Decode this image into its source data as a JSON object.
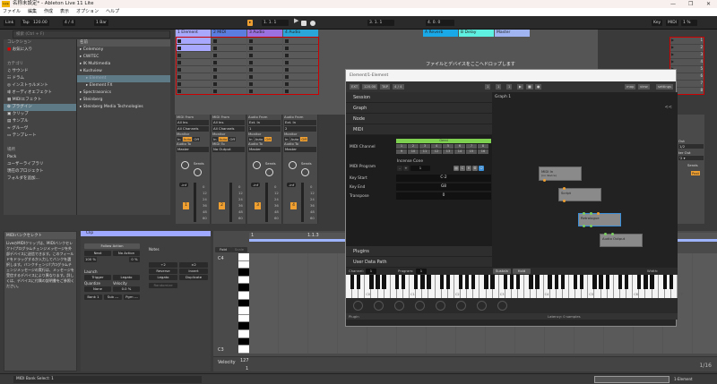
{
  "window": {
    "title": "名称未設定* - Ableton Live 11 Lite",
    "app_icon": "Live",
    "minimize": "—",
    "maximize": "❐",
    "close": "✕"
  },
  "menu": [
    "ファイル",
    "編集",
    "作成",
    "表示",
    "オプション",
    "ヘルプ"
  ],
  "toolbar": {
    "link": "Link",
    "tap": "Tap",
    "tempo": "120.00",
    "signature": "4 / 4",
    "quantize": "1 Bar",
    "position": "1.  1.  1",
    "loop_start": "3.  1.  1",
    "loop_length": "4.  0.  0",
    "key": "Key",
    "midi": "MIDI",
    "cpu": "1 %"
  },
  "browser": {
    "search_placeholder": "検索 (Ctrl + F)",
    "collections_header": "コレクション",
    "favorites": "お気に入り",
    "categories_header": "カテゴリ",
    "categories": [
      "サウンド",
      "ドラム",
      "インストゥルメント",
      "オーディオエフェクト",
      "MIDIエフェクト",
      "プラグイン",
      "クリップ",
      "サンプル",
      "グルーヴ",
      "テンプレート"
    ],
    "places_header": "場所",
    "places": [
      "Pack",
      "ユーザーライブラリ",
      "現在のプロジェクト",
      "フォルダを追加..."
    ],
    "names_header": "名前",
    "names": [
      "Celemony",
      "CWITEC",
      "IK Multimedia",
      "Kushview",
      "Element",
      "Element FX",
      "Spectrasonics",
      "Steinberg",
      "Steinberg Media Technologies"
    ]
  },
  "session": {
    "tracks": [
      {
        "name": "1 Element",
        "color": "#a8a8ff"
      },
      {
        "name": "2 MIDI",
        "color": "#5b7de0"
      },
      {
        "name": "3 Audio",
        "color": "#9b70e0"
      },
      {
        "name": "4 Audio",
        "color": "#2aa7d8"
      }
    ],
    "returns": [
      {
        "name": "A Reverb",
        "color": "#19a9e8"
      },
      {
        "name": "B Delay",
        "color": "#5ef0e0"
      },
      {
        "name": "Master",
        "color": "#9fb4f0"
      }
    ],
    "scenes": [
      "1",
      "2",
      "3",
      "4",
      "5",
      "6",
      "7",
      "8"
    ],
    "drop_text": "ファイルとデバイスをここへドロップします"
  },
  "mixer": [
    {
      "from_label": "MIDI From",
      "from": "All Ins",
      "channel": "All Channels",
      "monitor_label": "Monitor",
      "mon": [
        "In",
        "Auto",
        "Off"
      ],
      "to_label": "Audio To",
      "to": "Master",
      "sends": "Sends",
      "vol": "-inf",
      "num": "1"
    },
    {
      "from_label": "MIDI From",
      "from": "All Ins",
      "channel": "All Channels",
      "monitor_label": "Monitor",
      "mon": [
        "In",
        "Auto",
        "Off"
      ],
      "to_label": "MIDI To",
      "to": "No Output",
      "sends": "",
      "vol": "",
      "num": "2"
    },
    {
      "from_label": "Audio From",
      "from": "Ext. In",
      "channel": "1",
      "monitor_label": "Monitor",
      "mon": [
        "In",
        "Auto",
        "Off"
      ],
      "to_label": "Audio To",
      "to": "Master",
      "sends": "Sends",
      "vol": "-inf",
      "num": "3"
    },
    {
      "from_label": "Audio From",
      "from": "Ext. In",
      "channel": "2",
      "monitor_label": "Monitor",
      "mon": [
        "In",
        "Auto",
        "Off"
      ],
      "to_label": "Audio To",
      "to": "Master",
      "sends": "Sends",
      "vol": "-inf",
      "num": "4"
    }
  ],
  "meter_scale": [
    "0",
    "12",
    "24",
    "36",
    "48",
    "60"
  ],
  "master_strip": {
    "cue_out": "Out",
    "master_out": "ter Out",
    "value": "1/2",
    "sends": "Sends",
    "post": "Post"
  },
  "plugin": {
    "title": "Element/1-Element",
    "ext": "EXT",
    "tempo": "120.00",
    "tap": "TAP",
    "sig": "4 / 4",
    "pos": [
      "1",
      "1",
      "1"
    ],
    "map": "map",
    "view": "view",
    "settings": "settings",
    "sections": [
      "Session",
      "Graph",
      "Node",
      "MIDI"
    ],
    "midi_channel_label": "MIDI Channel",
    "omni": "Omni",
    "channels": [
      "1",
      "2",
      "3",
      "4",
      "5",
      "6",
      "7",
      "8",
      "9",
      "10",
      "11",
      "12",
      "13",
      "14",
      "15",
      "16"
    ],
    "midi_program_label": "MIDI Program",
    "program_name": "Incense Cone",
    "program_value": "1",
    "key_start_label": "Key Start",
    "key_start": "C-2",
    "key_end_label": "Key End",
    "key_end": "G8",
    "transpose_label": "Transpose",
    "transpose": "0",
    "plugins": "Plugins",
    "user_data_path": "User Data Path",
    "graph_title": "Graph 1",
    "nodes": {
      "midi_in": "MIDI In",
      "midi_in_sub": "(no device)",
      "script": "Script",
      "retrologue": "Retrologue",
      "audio_output": "Audio Output"
    },
    "channel_label": "Channel:",
    "channel": "1",
    "program_label": "Program:",
    "program": "1",
    "sustain": "Sustain",
    "hold": "Hold",
    "width_label": "Width:",
    "octaves": [
      "C0",
      "C1",
      "C2",
      "C3",
      "C4",
      "C5",
      "C6",
      "C7"
    ],
    "status_left": "Plugin",
    "latency": "Latency: 0 samples"
  },
  "info": {
    "title": "MIDIバンクセレクト",
    "body": "LiveのMIDIクリップは、MIDIバンクセレクト/プログラムチェンジメッセージを外部デバイスに送信できます。このフィールドをドラッグするか入力してバンクを選択します。バンクチェンジ/プログラムチェンジメッセージの実行は、メッセージを受信するデバイスにより異なります。詳しくは、デバイスに付属の説明書をご参照ください。"
  },
  "clip": {
    "name": "Clip",
    "follow_action": "Follow Action",
    "next": "Next",
    "no_action": "No Action",
    "pct1": "100 %",
    "pct2": "0 %",
    "launch": "Launch",
    "trigger": "Trigger",
    "legato": "Legato",
    "quantize": "Quantize",
    "velocity": "Velocity",
    "quant_val": "None",
    "vel_val": "0.0 %",
    "bank": "Bank 1",
    "sub": "Sub ---",
    "pgm": "Pgm ---",
    "notes": "Notes",
    "x2a": "÷2",
    "x2b": "×2",
    "reverse": "Reverse",
    "invert": "Invert",
    "legato_btn": "Legato",
    "duplicate": "Duplicate",
    "randomize": "Randomize"
  },
  "roll": {
    "fold": "Fold",
    "scale": "Scale",
    "c4": "C4",
    "c3": "C3",
    "velocity": "Velocity",
    "v127": "127",
    "v1": "1",
    "marker1": "1",
    "marker2": "1.1.3",
    "grid": "1/16"
  },
  "status": {
    "text": "MIDI Bank Select: 1",
    "track": "1-Element"
  }
}
